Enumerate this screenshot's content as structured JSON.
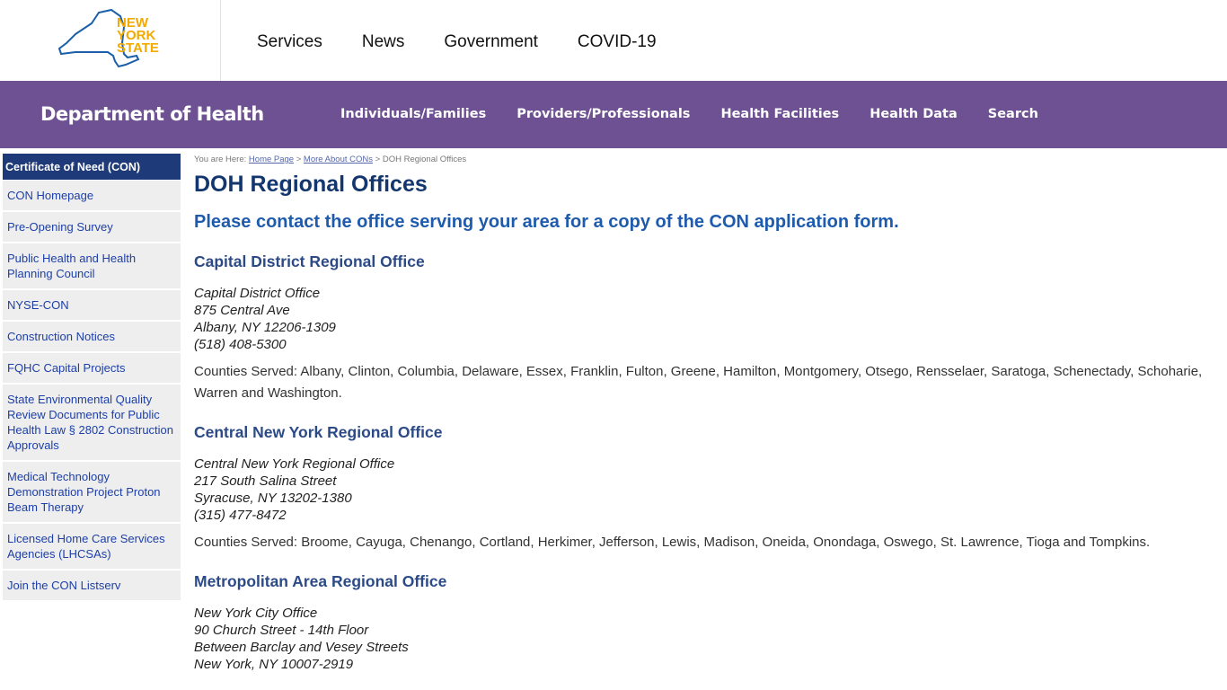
{
  "state_header": {
    "logo_text": [
      "NEW",
      "YORK",
      "STATE"
    ],
    "nav": [
      "Services",
      "News",
      "Government",
      "COVID-19"
    ]
  },
  "doh_bar": {
    "title": "Department of Health",
    "nav": [
      "Individuals/Families",
      "Providers/Professionals",
      "Health Facilities",
      "Health Data",
      "Search"
    ]
  },
  "sidebar": {
    "header": "Certificate of Need (CON)",
    "items": [
      "CON Homepage",
      "Pre-Opening Survey",
      "Public Health and Health Planning Council",
      "NYSE-CON",
      "Construction Notices",
      "FQHC Capital Projects",
      "State Environmental Quality Review Documents for Public Health Law § 2802 Construction Approvals",
      "Medical Technology Demonstration Project Proton Beam Therapy",
      "Licensed Home Care Services Agencies (LHCSAs)",
      "Join the CON Listserv"
    ]
  },
  "breadcrumb": {
    "prefix": "You are Here: ",
    "links": [
      "Home Page",
      "More About CONs"
    ],
    "separator": " > ",
    "current": "DOH Regional Offices"
  },
  "page": {
    "title": "DOH Regional Offices",
    "lead": "Please contact the office serving your area for a copy of the CON application form."
  },
  "offices": [
    {
      "title": "Capital District Regional Office",
      "address": [
        "Capital District Office",
        "875 Central Ave",
        "Albany, NY 12206-1309",
        "(518) 408-5300"
      ],
      "counties": "Counties Served: Albany, Clinton, Columbia, Delaware, Essex, Franklin, Fulton, Greene, Hamilton, Montgomery, Otsego, Rensselaer, Saratoga, Schenectady, Schoharie, Warren and Washington."
    },
    {
      "title": "Central New York Regional Office",
      "address": [
        "Central New York Regional Office",
        "217 South Salina Street",
        "Syracuse, NY 13202-1380",
        "(315) 477-8472"
      ],
      "counties": "Counties Served: Broome, Cayuga, Chenango, Cortland, Herkimer, Jefferson, Lewis, Madison, Oneida, Onondaga, Oswego, St. Lawrence, Tioga and Tompkins."
    },
    {
      "title": "Metropolitan Area Regional Office",
      "address": [
        "New York City Office",
        "90 Church Street - 14th Floor",
        "Between Barclay and Vesey Streets",
        "New York, NY 10007-2919"
      ],
      "counties": ""
    }
  ],
  "colors": {
    "purple_bar": "#6e5192",
    "sidebar_header": "#1e3a78",
    "link_blue": "#1d3fa8",
    "title_navy": "#13366f",
    "logo_gold": "#f2a900",
    "logo_blue": "#1a5fa8"
  }
}
